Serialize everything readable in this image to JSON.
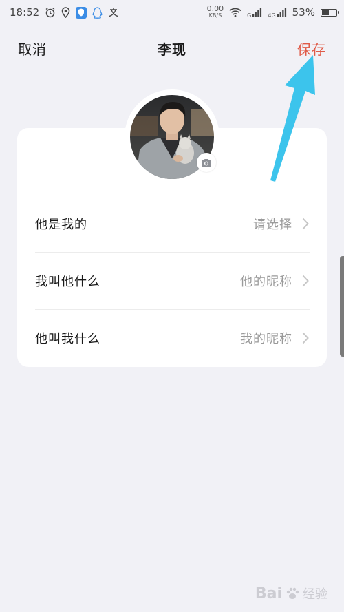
{
  "colors": {
    "accent": "#e05a47",
    "background": "#f1f1f6",
    "card": "#ffffff",
    "arrow": "#3cc4ec"
  },
  "status_bar": {
    "time": "18:52",
    "net_speed_value": "0.00",
    "net_speed_unit": "KB/S",
    "signal1_label": "G",
    "signal2_label": "4G",
    "battery_percent": "53%",
    "battery_level": 0.53,
    "icons": [
      "alarm-icon",
      "location-icon",
      "shield-app-icon",
      "qq-icon",
      "translate-icon",
      "wifi-icon",
      "signal-icon",
      "battery-icon"
    ]
  },
  "nav": {
    "cancel_label": "取消",
    "title": "李现",
    "save_label": "保存"
  },
  "avatar": {
    "icon": "camera-icon"
  },
  "rows": [
    {
      "label": "他是我的",
      "value": "请选择"
    },
    {
      "label": "我叫他什么",
      "value": "他的昵称"
    },
    {
      "label": "他叫我什么",
      "value": "我的昵称"
    }
  ],
  "watermark": {
    "text": "Bai",
    "sub": "经验"
  }
}
